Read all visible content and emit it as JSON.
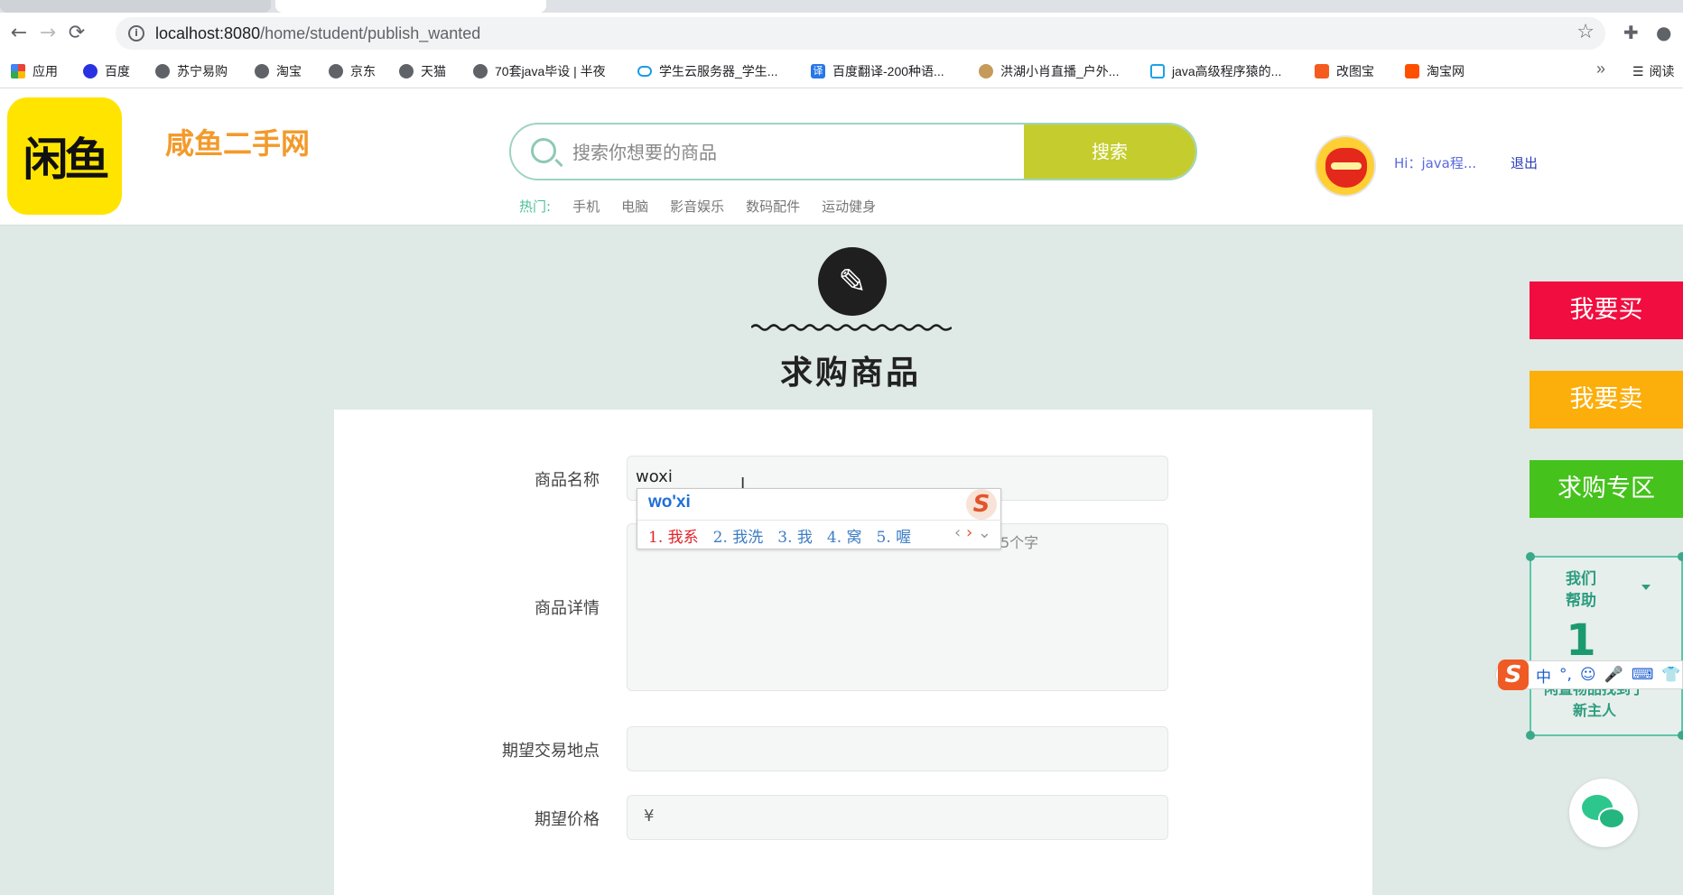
{
  "browser": {
    "url_host": "localhost:8080",
    "url_path": "/home/student/publish_wanted",
    "bookmarks": [
      {
        "label": "应用",
        "icon": "apps-grid-icon"
      },
      {
        "label": "百度",
        "icon": "baidu-icon"
      },
      {
        "label": "苏宁易购",
        "icon": "globe-icon"
      },
      {
        "label": "淘宝",
        "icon": "globe-icon"
      },
      {
        "label": "京东",
        "icon": "globe-icon"
      },
      {
        "label": "天猫",
        "icon": "globe-icon"
      },
      {
        "label": "70套java毕设 | 半夜",
        "icon": "globe-icon"
      },
      {
        "label": "学生云服务器_学生...",
        "icon": "cloud-icon"
      },
      {
        "label": "百度翻译-200种语...",
        "icon": "translate-icon"
      },
      {
        "label": "洪湖小肖直播_户外...",
        "icon": "bird-icon"
      },
      {
        "label": "java高级程序猿的...",
        "icon": "bilibili-icon"
      },
      {
        "label": "改图宝",
        "icon": "image-edit-icon"
      },
      {
        "label": "淘宝网",
        "icon": "taobao-icon"
      }
    ],
    "reading_list": "阅读"
  },
  "header": {
    "logo_text": "闲鱼",
    "site_name": "咸鱼二手网",
    "search_placeholder": "搜索你想要的商品",
    "search_button": "搜索",
    "hot_label": "热门:",
    "hot_items": [
      "手机",
      "电脑",
      "影音娱乐",
      "数码配件",
      "运动健身"
    ],
    "user_greeting": "Hi：java程...",
    "logout": "退出"
  },
  "page": {
    "title": "求购商品"
  },
  "form": {
    "name_label": "商品名称",
    "name_value": "woxi",
    "detail_label": "商品详情",
    "char_hint": "5个字",
    "place_label": "期望交易地点",
    "price_label": "期望价格",
    "price_prefix": "¥"
  },
  "ime": {
    "composition": "wo'xi",
    "candidates": [
      "1. 我系",
      "2. 我洗",
      "3. 我",
      "4. 窝",
      "5. 喔"
    ],
    "bar_items": [
      "中",
      "°,",
      "☺",
      "🎤",
      "⌨",
      "👕"
    ]
  },
  "sidebar": {
    "buy": "我要买",
    "sell": "我要卖",
    "wanted": "求购专区",
    "helper_title": "我们\n帮助",
    "helper_count": "1",
    "helper_sub": "闲置物品找到了\n新主人"
  },
  "colors": {
    "buy": "#f10d3f",
    "sell": "#fcae0b",
    "wanted": "#46c21d",
    "search_button": "#c4cd2d",
    "site_name": "#f39a2b",
    "logo_bg": "#ffe400"
  }
}
